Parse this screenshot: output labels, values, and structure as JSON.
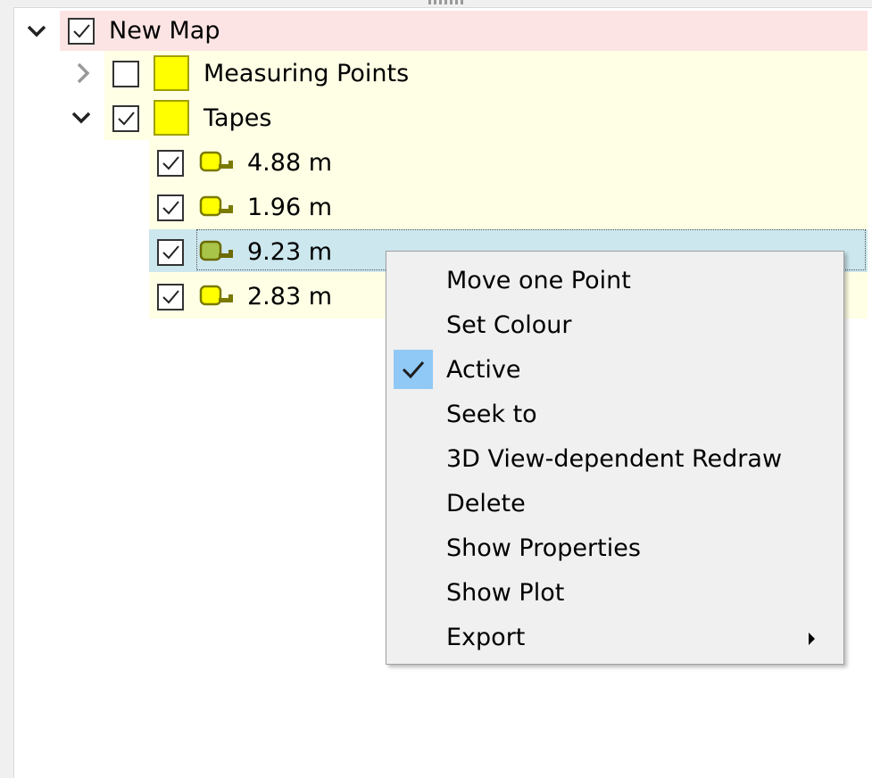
{
  "tree": {
    "root": {
      "label": "New Map",
      "expanded": true,
      "checked": true,
      "highlight": "#fde4e4"
    },
    "groups": [
      {
        "label": "Measuring Points",
        "expanded": false,
        "checked": false,
        "color": "#ffff00"
      },
      {
        "label": "Tapes",
        "expanded": true,
        "checked": true,
        "color": "#ffff00"
      }
    ],
    "tapes": [
      {
        "label": "4.88 m",
        "checked": true,
        "selected": false
      },
      {
        "label": "1.96 m",
        "checked": true,
        "selected": false
      },
      {
        "label": "9.23 m",
        "checked": true,
        "selected": true
      },
      {
        "label": "2.83 m",
        "checked": true,
        "selected": false
      }
    ],
    "colors": {
      "group_highlight": "#ffffe6",
      "selected_row": "#cce7ee",
      "tape_fill": "#ffff00",
      "tape_fill_selected": "#a8c54a",
      "tape_stroke": "#7a7a00"
    }
  },
  "context_menu": {
    "items": [
      {
        "label": "Move one Point"
      },
      {
        "label": "Set Colour"
      },
      {
        "label": "Active",
        "checked": true
      },
      {
        "label": "Seek to"
      },
      {
        "label": "3D View-dependent Redraw"
      },
      {
        "label": "Delete"
      },
      {
        "label": "Show Properties"
      },
      {
        "label": "Show Plot"
      },
      {
        "label": "Export",
        "has_submenu": true
      }
    ],
    "check_highlight": "#90c8f6"
  }
}
